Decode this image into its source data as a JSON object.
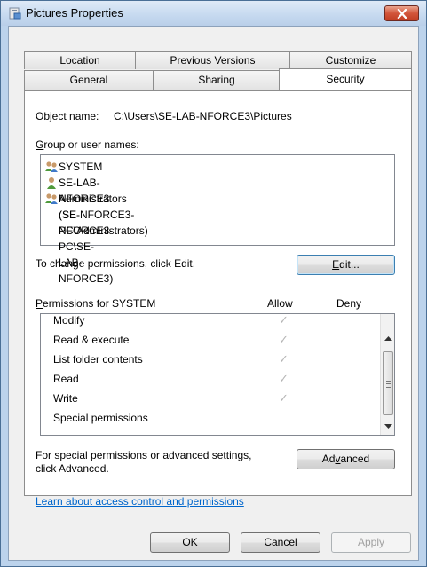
{
  "window": {
    "title": "Pictures Properties"
  },
  "tabs_row1": [
    {
      "label": "Location"
    },
    {
      "label": "Previous Versions"
    },
    {
      "label": "Customize"
    }
  ],
  "tabs_row2": [
    {
      "label": "General"
    },
    {
      "label": "Sharing"
    },
    {
      "label": "Security",
      "active": true
    }
  ],
  "security": {
    "object_name_label": "Object name:",
    "object_name_value": "C:\\Users\\SE-LAB-NFORCE3\\Pictures",
    "group_label_accel": "G",
    "group_label_rest": "roup or user names:",
    "users": [
      {
        "name": "SYSTEM",
        "icon": "user-group-icon"
      },
      {
        "name": "SE-LAB-NFORCE3 (SE-NFORCE3-PC\\SE-LAB-NFORCE3)",
        "icon": "user-icon"
      },
      {
        "name": "Administrators (SE-NFORCE3-PC\\Administrators)",
        "icon": "user-group-icon"
      }
    ],
    "change_text": "To change permissions, click Edit.",
    "edit_accel": "E",
    "edit_rest": "dit...",
    "perm_label_accel": "P",
    "perm_label_rest": "ermissions for SYSTEM",
    "allow_header": "Allow",
    "deny_header": "Deny",
    "permissions": [
      {
        "name": "Modify",
        "allow": "✓",
        "deny": ""
      },
      {
        "name": "Read & execute",
        "allow": "✓",
        "deny": ""
      },
      {
        "name": "List folder contents",
        "allow": "✓",
        "deny": ""
      },
      {
        "name": "Read",
        "allow": "✓",
        "deny": ""
      },
      {
        "name": "Write",
        "allow": "✓",
        "deny": ""
      },
      {
        "name": "Special permissions",
        "allow": "",
        "deny": ""
      }
    ],
    "special_text_1": "For special permissions or advanced settings,",
    "special_text_2": "click Advanced.",
    "advanced_pre": "Ad",
    "advanced_accel": "v",
    "advanced_post": "anced",
    "learn_link": "Learn about access control and permissions"
  },
  "buttons": {
    "ok": "OK",
    "cancel": "Cancel",
    "apply_accel": "A",
    "apply_rest": "pply"
  },
  "colors": {
    "link": "#0066cc",
    "close_button": "#c94a2e",
    "title_bar": "#c7daf0"
  }
}
